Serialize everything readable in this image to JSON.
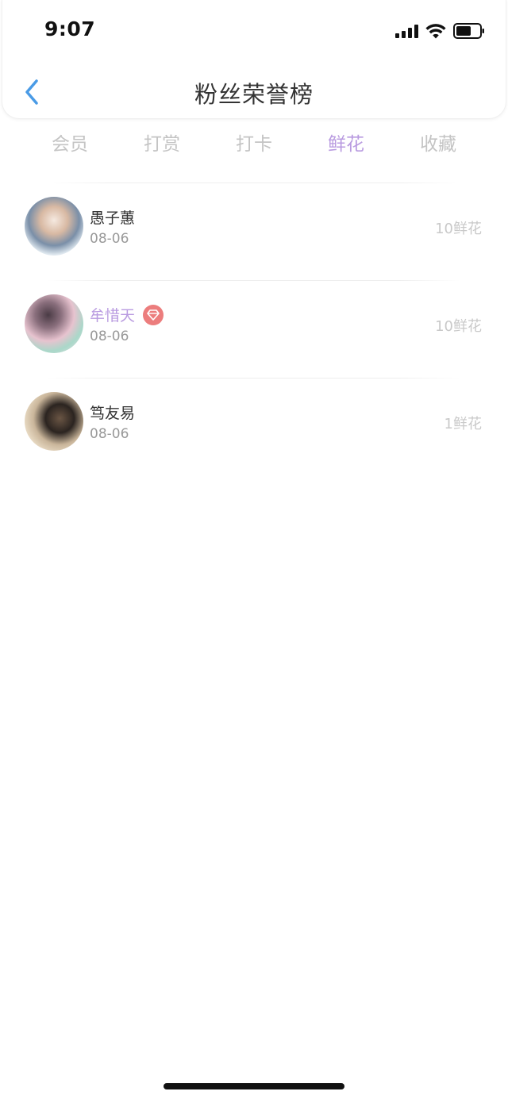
{
  "status_bar": {
    "time": "9:07"
  },
  "header": {
    "title": "粉丝荣誉榜",
    "back_icon": "chevron-left-icon",
    "accent_color": "#4a9be6"
  },
  "tabs": [
    {
      "label": "会员",
      "active": false
    },
    {
      "label": "打赏",
      "active": false
    },
    {
      "label": "打卡",
      "active": false
    },
    {
      "label": "鲜花",
      "active": true
    },
    {
      "label": "收藏",
      "active": false
    }
  ],
  "active_tab_color": "#b99be0",
  "fans": [
    {
      "name": "愚子蕙",
      "date": "08-06",
      "amount": "10鲜花",
      "vip": false
    },
    {
      "name": "牟惜天",
      "date": "08-06",
      "amount": "10鲜花",
      "vip": true
    },
    {
      "name": "笃友易",
      "date": "08-06",
      "amount": "1鲜花",
      "vip": false
    }
  ]
}
